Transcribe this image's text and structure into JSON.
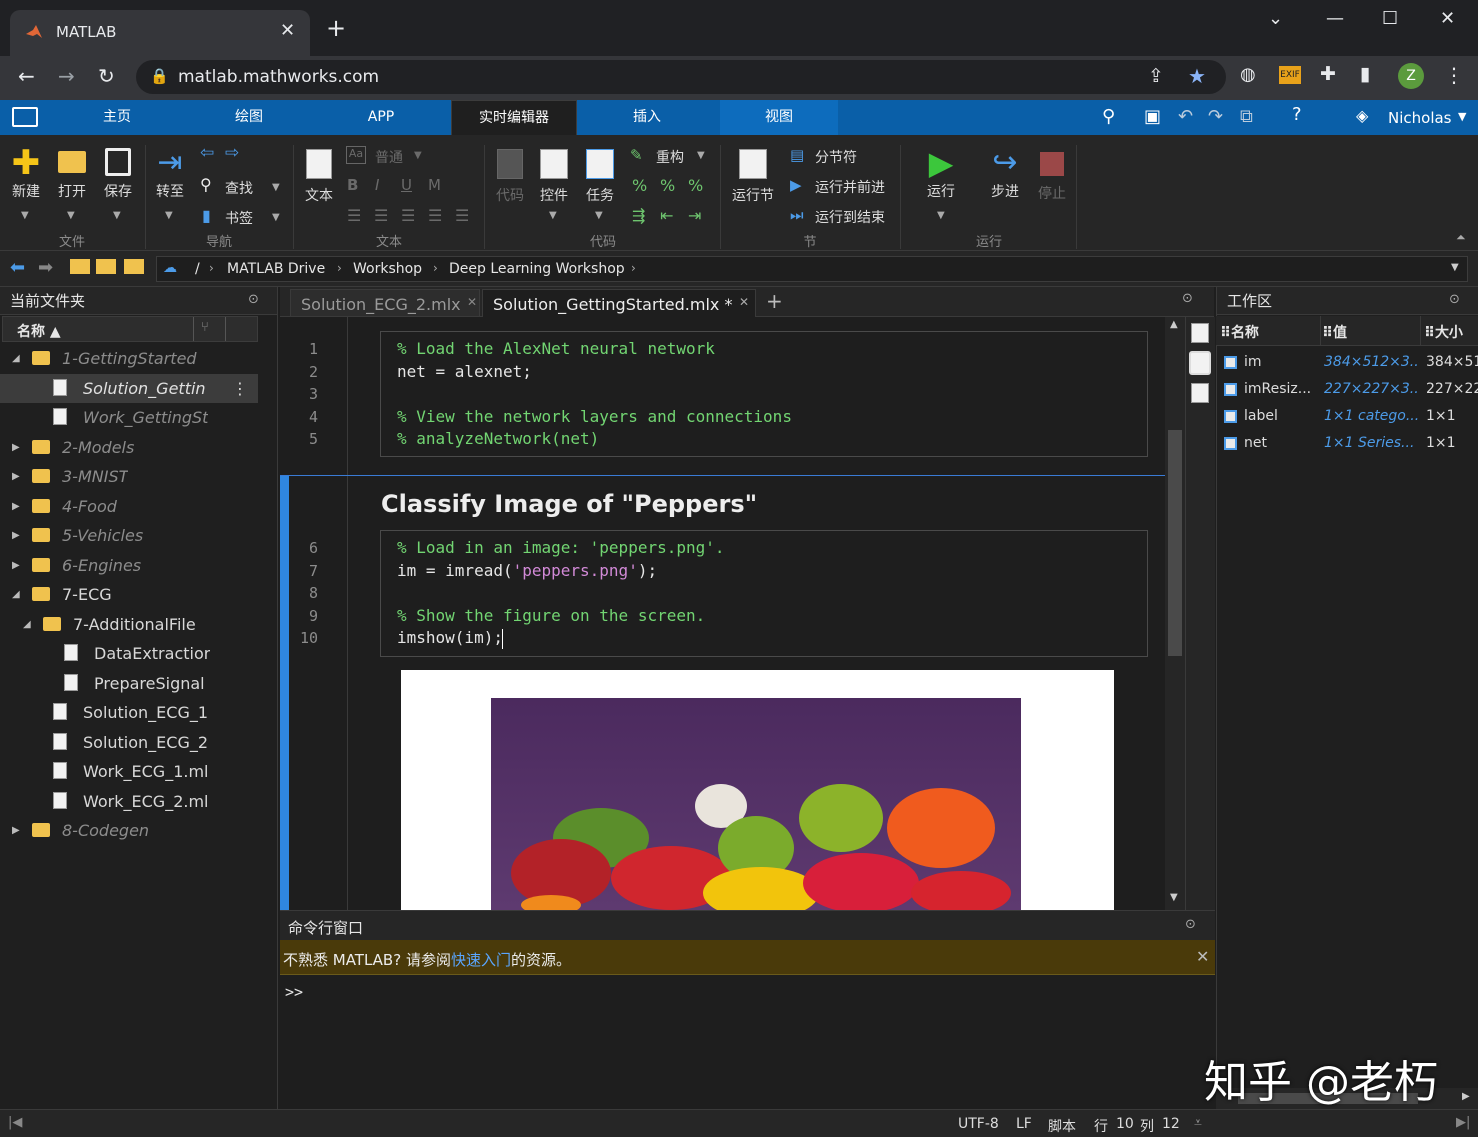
{
  "browser": {
    "tab_title": "MATLAB",
    "url": "matlab.mathworks.com",
    "avatar_letter": "Z"
  },
  "ribbon": {
    "tabs": [
      "主页",
      "绘图",
      "APP",
      "实时编辑器",
      "插入",
      "视图"
    ],
    "active_tab": "实时编辑器",
    "user": "Nicholas",
    "file": {
      "new": "新建",
      "open": "打开",
      "save": "保存",
      "group": "文件"
    },
    "nav": {
      "goto": "转至",
      "find": "查找",
      "bookmark": "书签",
      "group": "导航"
    },
    "text": {
      "text": "文本",
      "style": "普通",
      "group": "文本"
    },
    "code": {
      "code": "代码",
      "control": "控件",
      "task": "任务",
      "refactor": "重构",
      "group": "代码"
    },
    "section": {
      "run_section": "运行节",
      "section_break": "分节符",
      "run_advance": "运行并前进",
      "run_to_end": "运行到结束",
      "group": "节"
    },
    "run": {
      "run": "运行",
      "step": "步进",
      "stop": "停止",
      "group": "运行"
    }
  },
  "path": {
    "root": "/",
    "crumbs": [
      "MATLAB Drive",
      "Workshop",
      "Deep Learning Workshop"
    ]
  },
  "current_folder": {
    "title": "当前文件夹",
    "column": "名称 ▲",
    "rows": [
      {
        "label": "1-GettingStarted",
        "type": "folder",
        "indent": 0,
        "expanded": true,
        "italic": true
      },
      {
        "label": "Solution_Gettin",
        "type": "file",
        "indent": 1,
        "selected": true,
        "italic": true
      },
      {
        "label": "Work_GettingSt",
        "type": "file",
        "indent": 1,
        "italic": true
      },
      {
        "label": "2-Models",
        "type": "folder",
        "indent": 0,
        "italic": true
      },
      {
        "label": "3-MNIST",
        "type": "folder",
        "indent": 0,
        "italic": true
      },
      {
        "label": "4-Food",
        "type": "folder",
        "indent": 0,
        "italic": true
      },
      {
        "label": "5-Vehicles",
        "type": "folder",
        "indent": 0,
        "italic": true
      },
      {
        "label": "6-Engines",
        "type": "folder",
        "indent": 0,
        "italic": true
      },
      {
        "label": "7-ECG",
        "type": "folder",
        "indent": 0,
        "expanded": true
      },
      {
        "label": "7-AdditionalFile",
        "type": "folder",
        "indent": 1,
        "expanded": true
      },
      {
        "label": "DataExtractior",
        "type": "file",
        "indent": 2
      },
      {
        "label": "PrepareSignal",
        "type": "file",
        "indent": 2
      },
      {
        "label": "Solution_ECG_1",
        "type": "file",
        "indent": 1
      },
      {
        "label": "Solution_ECG_2",
        "type": "file",
        "indent": 1
      },
      {
        "label": "Work_ECG_1.ml",
        "type": "file",
        "indent": 1
      },
      {
        "label": "Work_ECG_2.ml",
        "type": "file",
        "indent": 1
      },
      {
        "label": "8-Codegen",
        "type": "folder",
        "indent": 0,
        "italic": true
      }
    ]
  },
  "editor": {
    "tabs": [
      {
        "label": "Solution_ECG_2.mlx",
        "active": false
      },
      {
        "label": "Solution_GettingStarted.mlx *",
        "active": true
      }
    ],
    "heading": "Classify Image of \"Peppers\"",
    "cell1": [
      {
        "n": "1",
        "parts": [
          {
            "t": "% Load the AlexNet neural network",
            "c": "cm"
          }
        ]
      },
      {
        "n": "2",
        "parts": [
          {
            "t": "net = alexnet;",
            "c": ""
          }
        ]
      },
      {
        "n": "3",
        "parts": [
          {
            "t": "",
            "c": ""
          }
        ]
      },
      {
        "n": "4",
        "parts": [
          {
            "t": "% View the network layers and connections",
            "c": "cm"
          }
        ]
      },
      {
        "n": "5",
        "parts": [
          {
            "t": "% analyzeNetwork(net)",
            "c": "cm"
          }
        ]
      }
    ],
    "cell2": [
      {
        "n": "6",
        "parts": [
          {
            "t": "% Load in an image: 'peppers.png'.",
            "c": "cm"
          }
        ]
      },
      {
        "n": "7",
        "parts": [
          {
            "t": "im = imread(",
            "c": ""
          },
          {
            "t": "'peppers.png'",
            "c": "str"
          },
          {
            "t": ");",
            "c": ""
          }
        ]
      },
      {
        "n": "8",
        "parts": [
          {
            "t": "",
            "c": ""
          }
        ]
      },
      {
        "n": "9",
        "parts": [
          {
            "t": "% Show the figure on the screen.",
            "c": "cm"
          }
        ]
      },
      {
        "n": "10",
        "parts": [
          {
            "t": "imshow(im);",
            "c": ""
          }
        ]
      }
    ]
  },
  "workspace": {
    "title": "工作区",
    "columns": [
      "名称",
      "值",
      "大小"
    ],
    "rows": [
      {
        "name": "im",
        "value": "384×512×3...",
        "size": "384×51"
      },
      {
        "name": "imResiz...",
        "value": "227×227×3...",
        "size": "227×22"
      },
      {
        "name": "label",
        "value": "1×1 catego...",
        "size": "1×1"
      },
      {
        "name": "net",
        "value": "1×1 Series...",
        "size": "1×1"
      }
    ]
  },
  "command": {
    "title": "命令行窗口",
    "notice_prefix": "不熟悉 MATLAB? 请参阅",
    "notice_link": "快速入门",
    "notice_suffix": "的资源。",
    "prompt": ">>"
  },
  "status": {
    "encoding": "UTF-8",
    "eol": "LF",
    "type": "脚本",
    "row_label": "行",
    "row": "10",
    "col_label": "列",
    "col": "12"
  },
  "watermark": "知乎 @老朽"
}
